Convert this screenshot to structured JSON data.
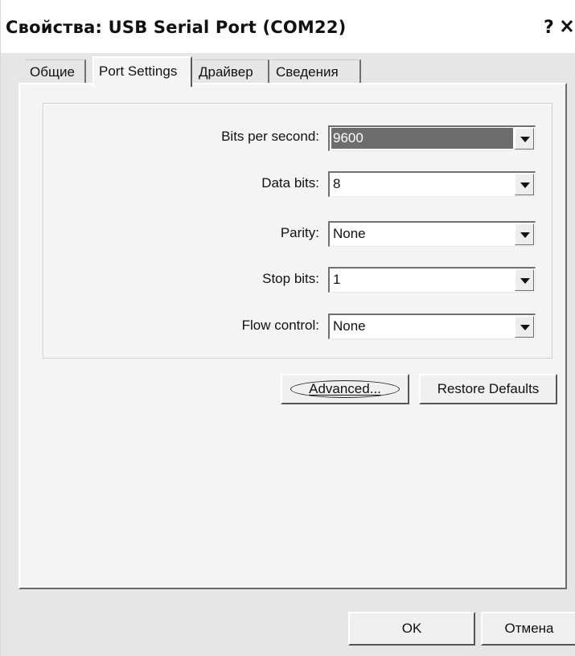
{
  "window": {
    "title": "Свойства: USB Serial Port (COM22)",
    "help_label": "?",
    "close_label": "✕"
  },
  "tabs": [
    {
      "label": "Общие",
      "active": false
    },
    {
      "label": "Port Settings",
      "active": true
    },
    {
      "label": "Драйвер",
      "active": false
    },
    {
      "label": "Сведения",
      "active": false
    }
  ],
  "port_settings": {
    "bits_per_second": {
      "label": "Bits per second:",
      "value": "9600"
    },
    "data_bits": {
      "label": "Data bits:",
      "value": "8"
    },
    "parity": {
      "label": "Parity:",
      "value": "None"
    },
    "stop_bits": {
      "label": "Stop bits:",
      "value": "1"
    },
    "flow_control": {
      "label": "Flow control:",
      "value": "None"
    }
  },
  "buttons": {
    "advanced": "Advanced...",
    "restore_defaults": "Restore Defaults",
    "ok": "OK",
    "cancel": "Отмена"
  },
  "icons": {
    "dropdown": "chevron-down-icon",
    "close": "close-icon",
    "help": "help-icon"
  }
}
